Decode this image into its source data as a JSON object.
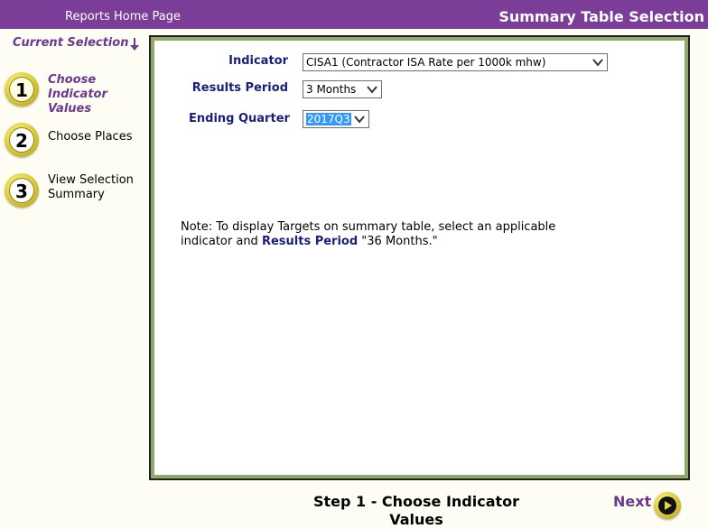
{
  "header": {
    "home_link": "Reports Home Page",
    "title": "Summary Table Selection"
  },
  "sidebar": {
    "current_selection": "Current Selection",
    "steps": [
      {
        "number": "1",
        "label": "Choose Indicator Values",
        "active": true
      },
      {
        "number": "2",
        "label": "Choose Places",
        "active": false
      },
      {
        "number": "3",
        "label": "View Selection Summary",
        "active": false
      }
    ]
  },
  "form": {
    "indicator_label": "Indicator",
    "indicator_value": "CISA1 (Contractor ISA Rate per 1000k mhw)",
    "period_label": "Results Period",
    "period_value": "3 Months",
    "quarter_label": "Ending Quarter",
    "quarter_value": "2017Q3"
  },
  "note": {
    "prefix": "Note: To display Targets on summary table, select an applicable indicator and ",
    "emphasis": "Results Period",
    "suffix": " \"36 Months.\""
  },
  "footer": {
    "step_title": "Step 1 - Choose Indicator Values",
    "next_label": "Next"
  },
  "colors": {
    "header_bg": "#7b3d98",
    "accent_purple": "#6b3a8e",
    "label_navy": "#1a1f7a",
    "badge_gold": "#e7d54a",
    "panel_border_green": "#90a86a"
  }
}
